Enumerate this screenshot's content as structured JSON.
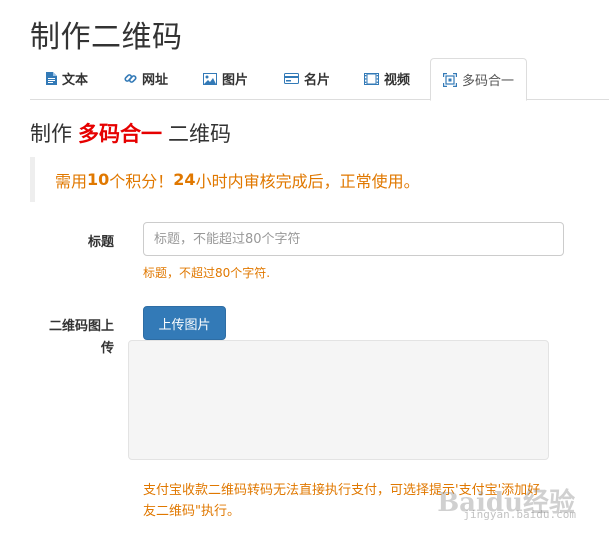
{
  "page": {
    "title": "制作二维码"
  },
  "tabs": [
    {
      "label": "文本",
      "icon": "file-text-icon"
    },
    {
      "label": "网址",
      "icon": "link-icon"
    },
    {
      "label": "图片",
      "icon": "image-icon"
    },
    {
      "label": "名片",
      "icon": "card-icon"
    },
    {
      "label": "视频",
      "icon": "film-icon"
    },
    {
      "label": "多码合一",
      "icon": "qrcode-icon",
      "active": true
    }
  ],
  "subtitle": {
    "prefix": "制作",
    "highlight": "多码合一",
    "suffix": "二维码"
  },
  "notice": {
    "p1": "需用",
    "points": "10",
    "p2": "个积分！",
    "hours": "24",
    "p3": "小时内审核完成后，正常使用。"
  },
  "form": {
    "title_label": "标题",
    "title_placeholder": "标题，不能超过80个字符",
    "title_help": "标题，不超过80个字符.",
    "upload_label": "二维码图上传",
    "upload_button": "上传图片",
    "upload_help": "支付宝收款二维码转码无法直接执行支付，可选择提示'支付宝'添加好友二维码\"执行。"
  },
  "watermark": {
    "text": "Baidu经验",
    "url": "jingyan.baidu.com"
  },
  "colors": {
    "accent": "#337ab7",
    "warning": "#e07800",
    "highlight": "#e60000"
  }
}
